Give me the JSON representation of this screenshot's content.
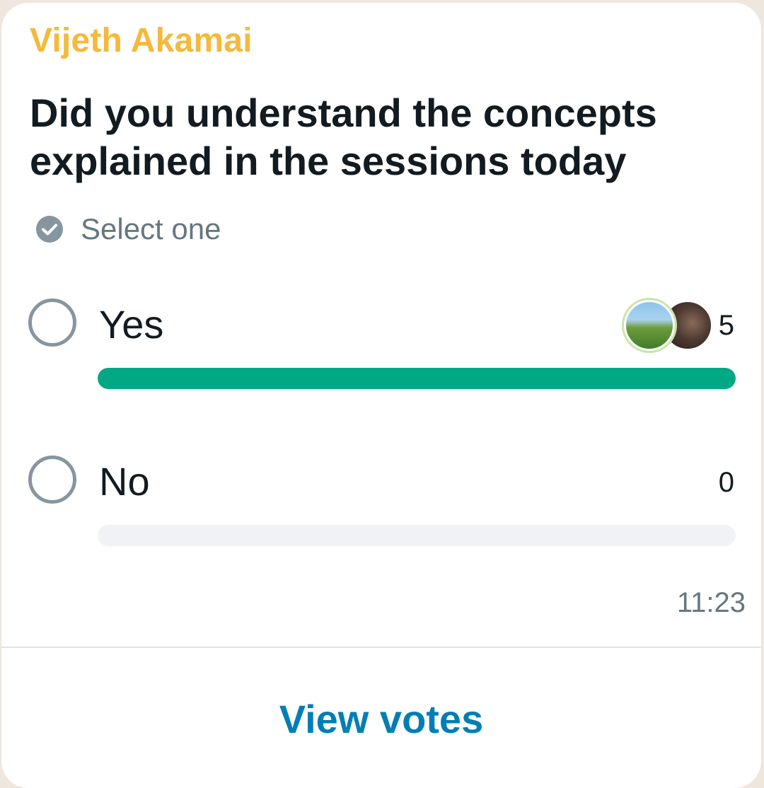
{
  "message": {
    "sender": "Vijeth Akamai",
    "time": "11:23"
  },
  "poll": {
    "question": "Did you understand the concepts explained in the sessions today",
    "hint": "Select one",
    "options": [
      {
        "label": "Yes",
        "count": "5",
        "fraction": 1.0
      },
      {
        "label": "No",
        "count": "0",
        "fraction": 0.0
      }
    ],
    "view_votes_label": "View votes"
  },
  "colors": {
    "sender": "#f5b93b",
    "bar_fill": "#00a884",
    "bar_track": "#f0f2f5",
    "link": "#027eb5"
  },
  "icons": {
    "hint": "check-circle-icon",
    "option": "radio-circle-icon"
  }
}
